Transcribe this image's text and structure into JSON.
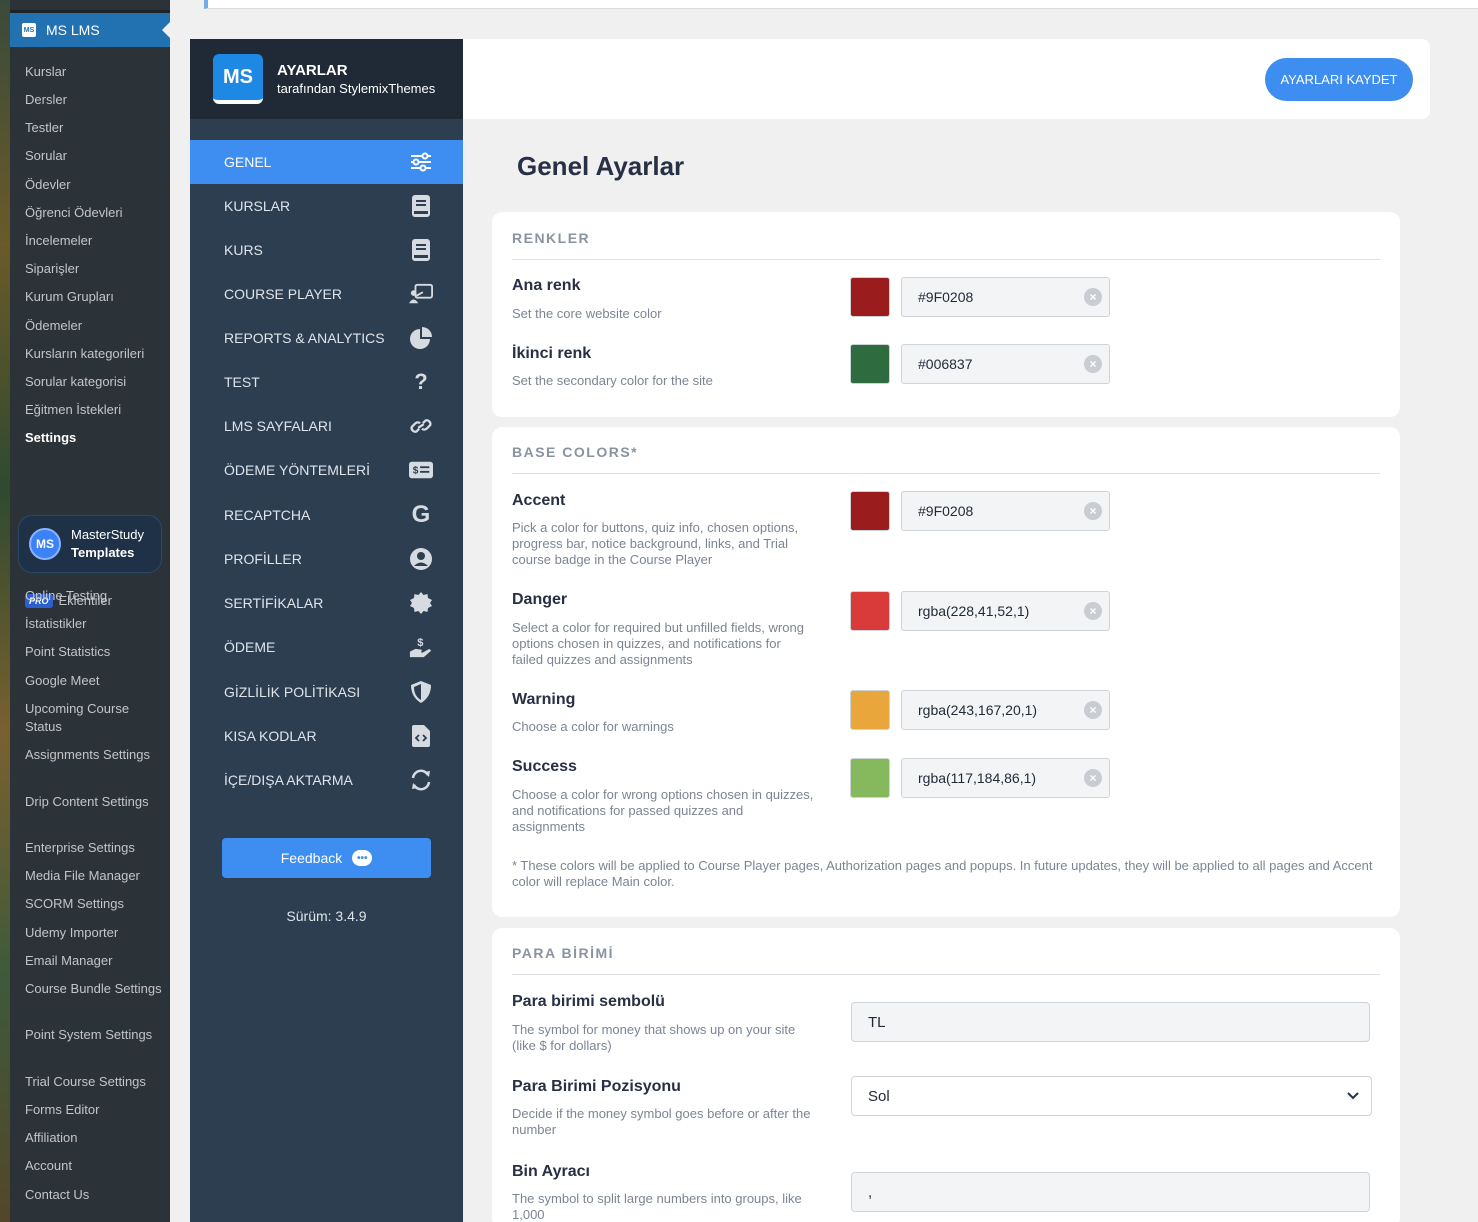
{
  "wp_sidebar": {
    "current_menu": "MS LMS",
    "items": [
      {
        "label": "Kurslar"
      },
      {
        "label": "Dersler"
      },
      {
        "label": "Testler"
      },
      {
        "label": "Sorular"
      },
      {
        "label": "Ödevler"
      },
      {
        "label": "Öğrenci Ödevleri"
      },
      {
        "label": "İncelemeler"
      },
      {
        "label": "Siparişler"
      },
      {
        "label": "Kurum Grupları"
      },
      {
        "label": "Ödemeler"
      },
      {
        "label": "Kursların kategorileri"
      },
      {
        "label": "Sorular kategorisi"
      },
      {
        "label": "Eğitmen İstekleri"
      },
      {
        "label": "Settings"
      }
    ],
    "templates_title": "MasterStudy",
    "templates_sub": "Templates",
    "pro_badge": "PRO",
    "addons_label": "Eklentiler",
    "pro_items": [
      {
        "label": "Online Testing"
      },
      {
        "label": "İstatistikler"
      },
      {
        "label": "Point Statistics"
      },
      {
        "label": "Google Meet"
      },
      {
        "label": "Upcoming Course Status"
      },
      {
        "label": "Assignments Settings"
      },
      {
        "label": "Drip Content Settings"
      },
      {
        "label": "Enterprise Settings"
      },
      {
        "label": "Media File Manager"
      },
      {
        "label": "SCORM Settings"
      },
      {
        "label": "Udemy Importer"
      },
      {
        "label": "Email Manager"
      },
      {
        "label": "Course Bundle Settings"
      },
      {
        "label": "Point System Settings"
      },
      {
        "label": "Trial Course Settings"
      },
      {
        "label": "Forms Editor"
      },
      {
        "label": "Affiliation"
      },
      {
        "label": "Account"
      },
      {
        "label": "Contact Us"
      }
    ]
  },
  "app": {
    "brand_title": "AYARLAR",
    "brand_sub": "tarafından StylemixThemes",
    "logo_text": "MS",
    "nav": [
      {
        "label": "GENEL",
        "icon": "sliders-icon"
      },
      {
        "label": "KURSLAR",
        "icon": "book-icon"
      },
      {
        "label": "KURS",
        "icon": "book-icon"
      },
      {
        "label": "COURSE PLAYER",
        "icon": "presentation-icon"
      },
      {
        "label": "REPORTS & ANALYTICS",
        "icon": "pie-chart-icon"
      },
      {
        "label": "TEST",
        "icon": "question-icon"
      },
      {
        "label": "LMS SAYFALARI",
        "icon": "link-icon"
      },
      {
        "label": "ÖDEME YÖNTEMLERİ",
        "icon": "money-bill-icon"
      },
      {
        "label": "RECAPTCHA",
        "icon": "google-icon"
      },
      {
        "label": "PROFİLLER",
        "icon": "user-circle-icon"
      },
      {
        "label": "SERTİFİKALAR",
        "icon": "certificate-icon"
      },
      {
        "label": "ÖDEME",
        "icon": "hand-dollar-icon"
      },
      {
        "label": "GİZLİLİK POLİTİKASI",
        "icon": "shield-icon"
      },
      {
        "label": "KISA KODLAR",
        "icon": "code-file-icon"
      },
      {
        "label": "İÇE/DIŞA AKTARMA",
        "icon": "sync-icon"
      }
    ],
    "feedback_label": "Feedback",
    "version": "Sürüm: 3.4.9",
    "save_label": "AYARLARI KAYDET"
  },
  "page": {
    "title": "Genel Ayarlar",
    "renkler": {
      "title": "RENKLER",
      "main": {
        "label": "Ana renk",
        "desc": "Set the core website color",
        "value": "#9F0208",
        "swatch": "#9b1c1c"
      },
      "secondary": {
        "label": "İkinci renk",
        "desc": "Set the secondary color for the site",
        "value": "#006837",
        "swatch": "#2e6b3f"
      }
    },
    "base": {
      "title": "BASE COLORS*",
      "accent": {
        "label": "Accent",
        "desc": "Pick a color for buttons, quiz info, chosen options, progress bar, notice background, links, and Trial course badge in the Course Player",
        "value": "#9F0208",
        "swatch": "#9b1c1c"
      },
      "danger": {
        "label": "Danger",
        "desc": "Select a color for required but unfilled fields, wrong options chosen in quizzes, and notifications for failed quizzes and assignments",
        "value": "rgba(228,41,52,1)",
        "swatch": "#d93b3b"
      },
      "warning": {
        "label": "Warning",
        "desc": "Choose a color for warnings",
        "value": "rgba(243,167,20,1)",
        "swatch": "#e9a63a"
      },
      "success": {
        "label": "Success",
        "desc": "Choose a color for wrong options chosen in quizzes, and notifications for passed quizzes and assignments",
        "value": "rgba(117,184,86,1)",
        "swatch": "#86b85d"
      },
      "note": "* These colors will be applied to Course Player pages, Authorization pages and popups. In future updates, they will be applied to all pages and Accent color will replace Main color."
    },
    "currency": {
      "title": "PARA BİRİMİ",
      "symbol": {
        "label": "Para birimi sembolü",
        "desc": "The symbol for money that shows up on your site (like $ for dollars)",
        "value": "TL"
      },
      "position": {
        "label": "Para Birimi Pozisyonu",
        "desc": "Decide if the money symbol goes before or after the number",
        "value": "Sol"
      },
      "thousands": {
        "label": "Bin Ayracı",
        "desc": "The symbol to split large numbers into groups, like 1,000",
        "value": ","
      }
    }
  }
}
